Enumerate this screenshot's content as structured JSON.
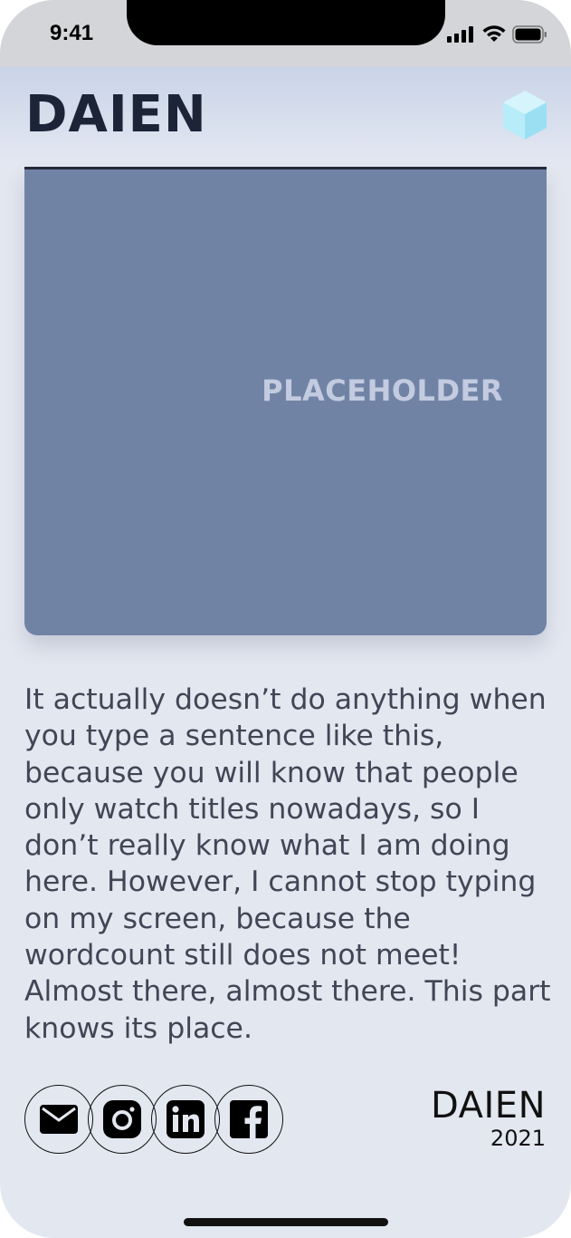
{
  "status_bar": {
    "time": "9:41"
  },
  "header": {
    "brand": "DAIEN",
    "logo_icon": "cube-logo-icon"
  },
  "hero": {
    "placeholder_label": "PLACEHOLDER",
    "background_color": "#7183a5"
  },
  "body": {
    "paragraph": "It actually doesn’t do anything when you type a sentence like this, because you will know that people only watch titles nowadays, so I don’t really know what I am doing here. However, I cannot stop typing on my screen, because the wordcount still does not meet! Almost there, almost there. This part knows its place."
  },
  "social_links": [
    {
      "icon": "mail-icon"
    },
    {
      "icon": "instagram-icon"
    },
    {
      "icon": "linkedin-icon"
    },
    {
      "icon": "facebook-icon"
    }
  ],
  "footer": {
    "brand": "DAIEN",
    "year": "2021"
  },
  "colors": {
    "page_background": "#e3e7f0",
    "text_dark": "#1c2538",
    "body_text": "#404655",
    "accent_cube": "#a8e6f5"
  }
}
